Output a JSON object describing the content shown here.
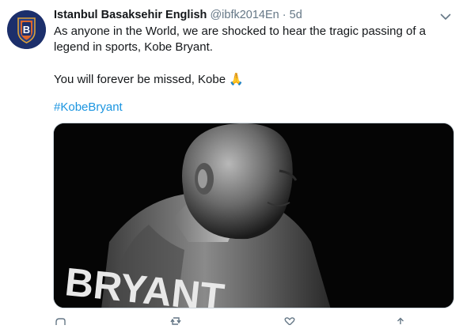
{
  "author": {
    "name": "Istanbul Basaksehir English",
    "handle": "@ibfk2014En",
    "separator": "·",
    "time": "5d"
  },
  "tweet": {
    "line1": "As anyone in the World, we are shocked to hear the tragic passing of a",
    "line2": "legend in sports, Kobe Bryant.",
    "line3": "You will forever be missed, Kobe",
    "emoji": "🙏",
    "hashtag": "#KobeBryant"
  },
  "media": {
    "jersey_text": "BRYANT"
  },
  "colors": {
    "link": "#1b95e0",
    "secondary_text": "#657786",
    "avatar_bg": "#1c2f6b",
    "emoji": "#f5a623"
  },
  "icons": [
    "reply-icon",
    "retweet-icon",
    "like-icon",
    "share-icon",
    "chevron-down-icon"
  ]
}
